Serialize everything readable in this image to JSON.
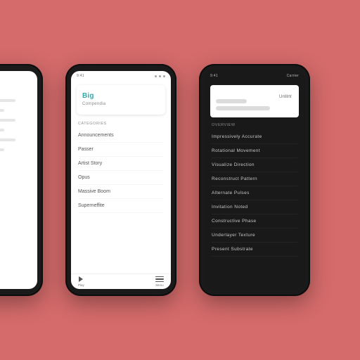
{
  "status": {
    "time": "9:41",
    "carrier": "Carrier"
  },
  "light": {
    "hero_title": "Big",
    "hero_sub": "Compendia",
    "section": "Categories",
    "items": [
      "Announcements",
      "Passer",
      "Artist Story",
      "Opus",
      "Massive Boom",
      "Superneffite"
    ],
    "nav_play": "Play",
    "nav_menu": "Menu"
  },
  "dark": {
    "hero_tag": "Untitrtr",
    "section": "Overview",
    "items": [
      "Impressively Accurate",
      "Rotational Movement",
      "Visualize Direction",
      "Reconstruct Pattern",
      "Alternate Pulses",
      "Invitation Noted",
      "Constructive Phase",
      "Underlayer Texture",
      "Present Substrate"
    ]
  }
}
